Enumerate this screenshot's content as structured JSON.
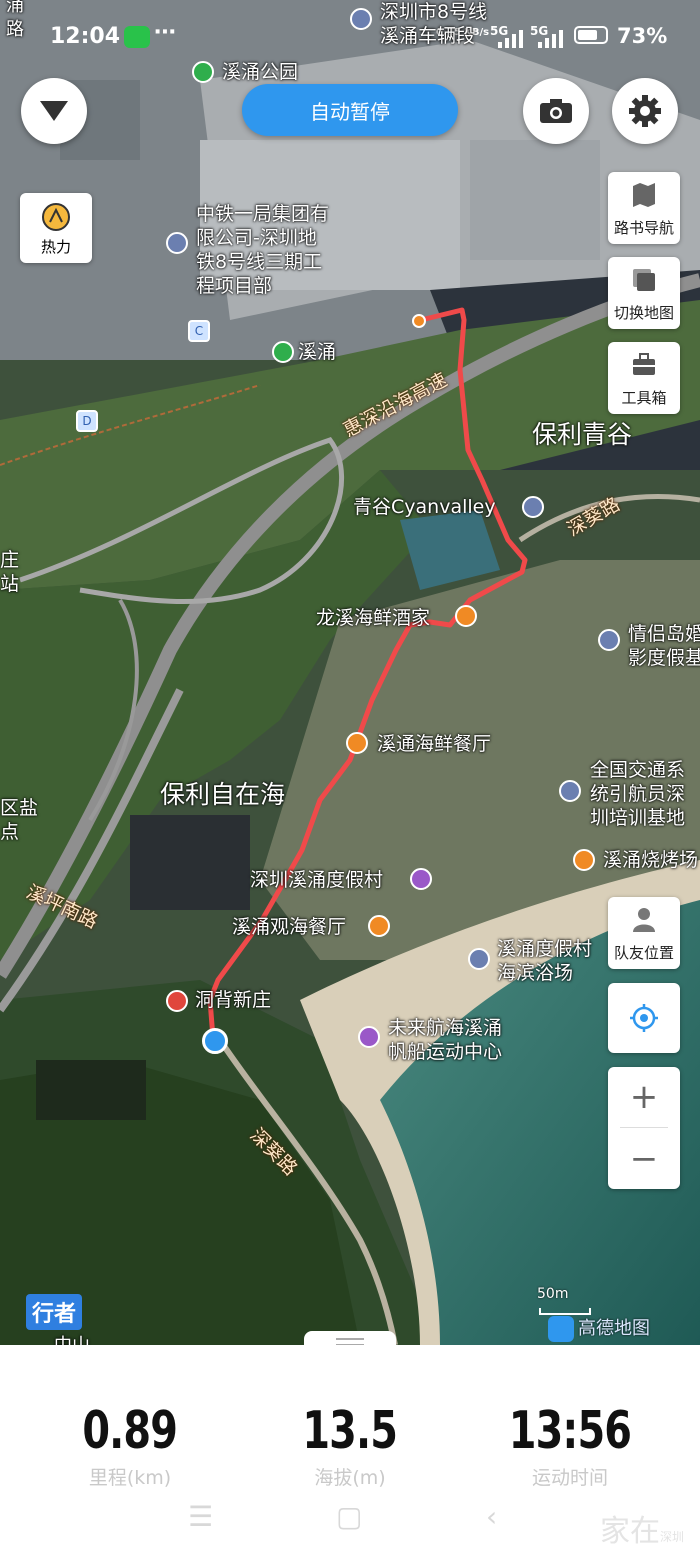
{
  "status": {
    "time": "12:04",
    "network_speed": "0.25 KB/s",
    "sig1": "5G",
    "sig2": "5G",
    "battery_level": 0.73,
    "battery": "73%"
  },
  "toolbar": {
    "auto_pause": "自动暂停",
    "heat": "热力"
  },
  "side": {
    "roadbook": "路书导航",
    "switch_map": "切换地图",
    "toolbox": "工具箱",
    "teammates": "队友位置"
  },
  "zoom": {
    "plus": "+",
    "minus": "−"
  },
  "map": {
    "labels": {
      "metro": "深圳市8号线\n溪涌车辆段",
      "park": "溪涌公园",
      "company": "中铁一局集团有\n限公司-深圳地\n铁8号线三期工\n程项目部",
      "xichong": "溪涌",
      "poly_qinggu": "保利青谷",
      "highway": "惠深沿海高速",
      "cyan": "青谷Cyanvalley",
      "shenkui1": "深葵路",
      "longxi": "龙溪海鲜酒家",
      "qinglv": "情侣岛婚\n影度假基",
      "xitong": "溪通海鲜餐厅",
      "poly_zizai": "保利自在海",
      "training": "全国交通系\n统引航员深\n圳培训基地",
      "bbq": "溪涌烧烤场",
      "resort": "深圳溪涌度假村",
      "seaview": "溪涌观海餐厅",
      "beach": "溪涌度假村\n海滨浴场",
      "xiping": "溪坪南路",
      "dongbei": "洞背新庄",
      "sailing": "未来航海溪涌\n帆船运动中心",
      "shenkui2": "深葵路",
      "left_zhan": "庄\n站",
      "left_yan": "区盐\n点",
      "top_left": "涌\n路",
      "bottom_zhongshan": "中山"
    },
    "scale": "50m",
    "brand": "高德地图",
    "app": "行者",
    "poi_letters": {
      "c": "C",
      "d": "D"
    }
  },
  "stats": [
    {
      "value": "0.89",
      "unit": "里程(km)"
    },
    {
      "value": "13.5",
      "unit": "海拔(m)"
    },
    {
      "value": "13:56",
      "unit": "运动时间"
    }
  ],
  "watermark": {
    "text": "家在",
    "sub": "深圳"
  }
}
